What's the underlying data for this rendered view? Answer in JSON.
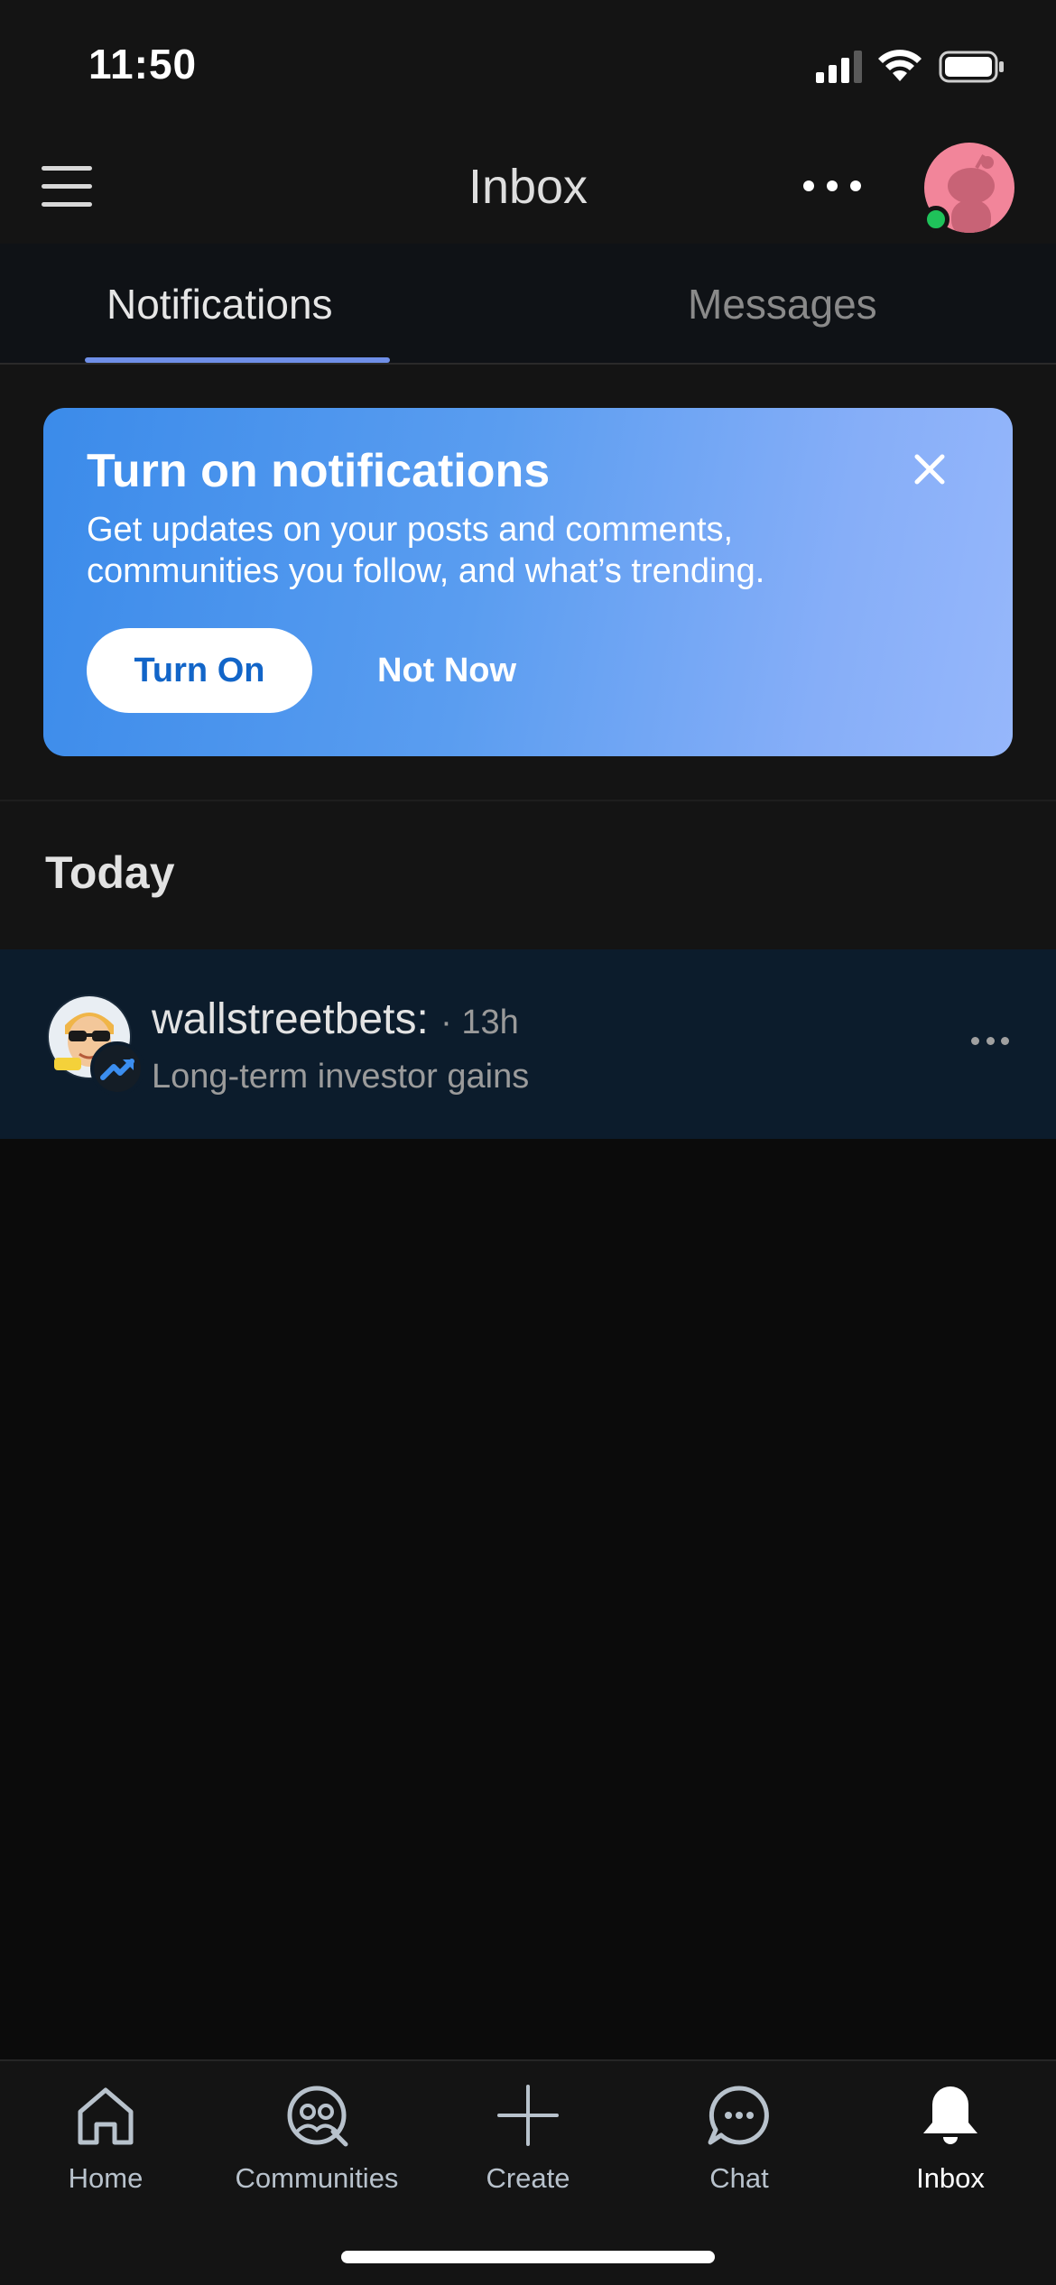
{
  "status_bar": {
    "time": "11:50"
  },
  "header": {
    "title": "Inbox"
  },
  "tabs": [
    {
      "label": "Notifications",
      "active": true
    },
    {
      "label": "Messages",
      "active": false
    }
  ],
  "banner": {
    "title": "Turn on notifications",
    "body": "Get updates on your posts and comments, communities you follow, and what’s trending.",
    "primary_button": "Turn On",
    "secondary_button": "Not Now"
  },
  "section": {
    "label": "Today"
  },
  "notifications": [
    {
      "title": "wallstreetbets:",
      "time": "· 13h",
      "subtitle": "Long-term investor gains",
      "icon": "trending-up-icon"
    }
  ],
  "bottom_nav": [
    {
      "label": "Home",
      "icon": "home-icon"
    },
    {
      "label": "Communities",
      "icon": "communities-icon"
    },
    {
      "label": "Create",
      "icon": "plus-icon"
    },
    {
      "label": "Chat",
      "icon": "chat-icon"
    },
    {
      "label": "Inbox",
      "icon": "bell-icon",
      "active": true
    }
  ],
  "colors": {
    "accent": "#6f8fe8",
    "banner_start": "#3b8bea",
    "banner_end": "#96b7fb",
    "online": "#1fc25a",
    "avatar_bg": "#f2859a"
  }
}
